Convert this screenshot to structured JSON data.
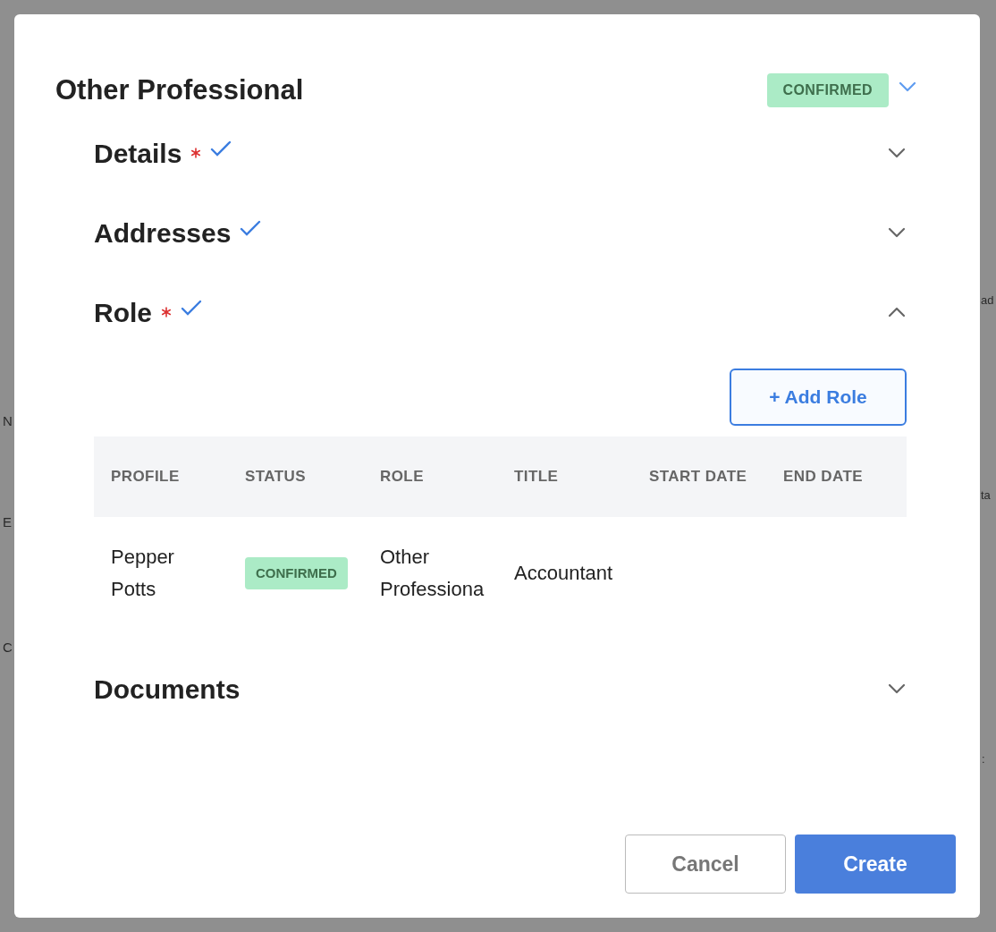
{
  "background": {
    "left": [
      "N",
      "E",
      "C"
    ],
    "right": [
      "ad",
      "ta",
      ":"
    ]
  },
  "modal": {
    "title": "Other Professional",
    "status": {
      "label": "CONFIRMED",
      "color": "#abebc6"
    }
  },
  "sections": [
    {
      "title": "Details",
      "required": true,
      "complete": true,
      "expanded": false
    },
    {
      "title": "Addresses",
      "required": false,
      "complete": true,
      "expanded": false
    },
    {
      "title": "Role",
      "required": true,
      "complete": true,
      "expanded": true,
      "add_button": "+ Add Role",
      "table": {
        "columns": [
          "PROFILE",
          "STATUS",
          "ROLE",
          "TITLE",
          "START DATE",
          "END DATE"
        ],
        "rows": [
          {
            "profile": "Pepper Potts",
            "status": {
              "label": "CONFIRMED",
              "color": "#abebc6"
            },
            "role": "Other Professiona",
            "title": "Accountant"
          }
        ]
      }
    },
    {
      "title": "Documents",
      "required": false,
      "complete": false,
      "expanded": false
    }
  ],
  "buttons": [
    {
      "label": "Cancel",
      "kind": "secondary"
    },
    {
      "label": "Create",
      "kind": "primary"
    }
  ]
}
